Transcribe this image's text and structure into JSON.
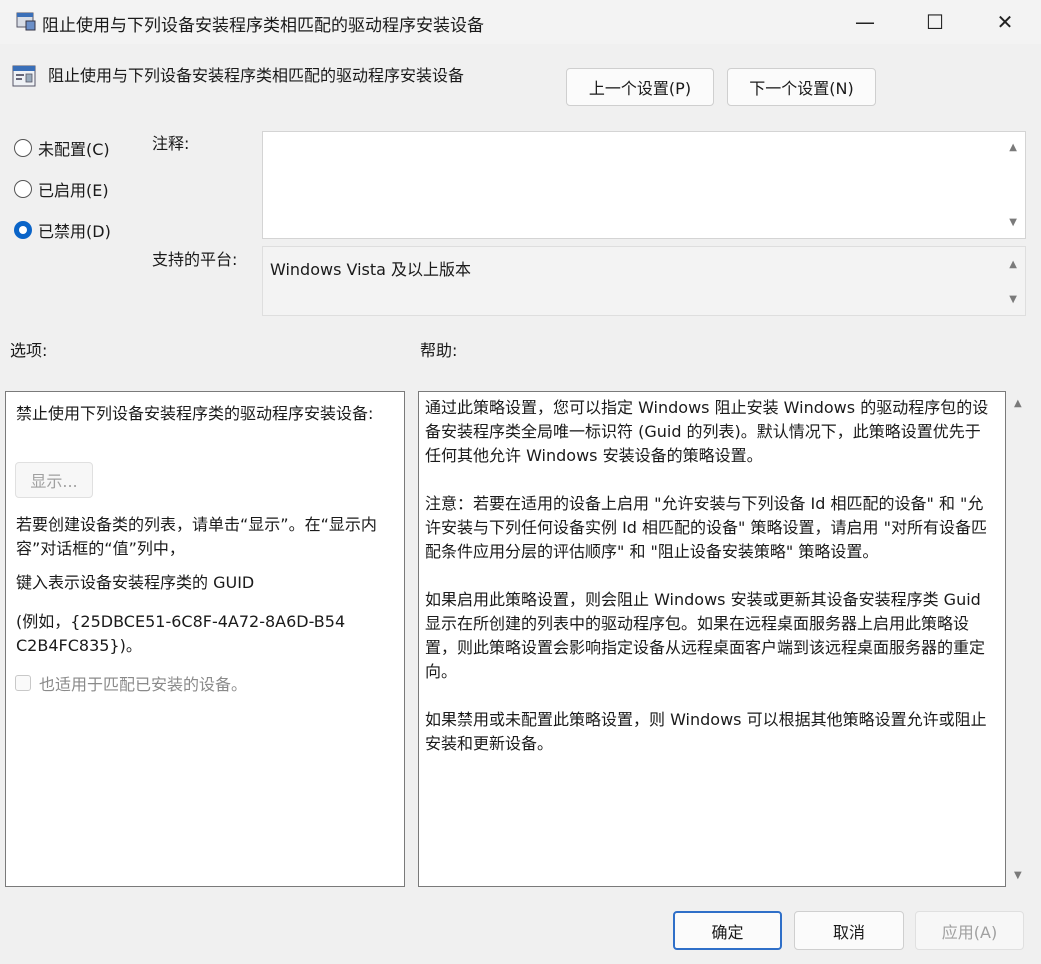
{
  "window": {
    "title": "阻止使用与下列设备安装程序类相匹配的驱动程序安装设备",
    "controls": {
      "minimize": "—",
      "maximize": "☐",
      "close": "✕"
    }
  },
  "header": {
    "policy_name": "阻止使用与下列设备安装程序类相匹配的驱动程序安装设备",
    "prev_button": "上一个设置(P)",
    "next_button": "下一个设置(N)"
  },
  "state": {
    "options": [
      {
        "label": "未配置(C)",
        "checked": false
      },
      {
        "label": "已启用(E)",
        "checked": false
      },
      {
        "label": "已禁用(D)",
        "checked": true
      }
    ]
  },
  "comment": {
    "label": "注释:",
    "value": ""
  },
  "platform": {
    "label": "支持的平台:",
    "value": "Windows Vista 及以上版本"
  },
  "options_section": {
    "label": "选项:",
    "heading": "禁止使用下列设备安装程序类的驱动程序安装设备:",
    "show_button": "显示...",
    "desc1": "若要创建设备类的列表，请单击“显示”。在“显示内容”对话框的“值”列中，",
    "desc2": "键入表示设备安装程序类的 GUID",
    "desc3": "(例如，{25DBCE51-6C8F-4A72-8A6D-B54C2B4FC835})。",
    "checkbox_label": "也适用于匹配已安装的设备。"
  },
  "help_section": {
    "label": "帮助:",
    "paragraphs": [
      "通过此策略设置，您可以指定 Windows 阻止安装 Windows 的驱动程序包的设备安装程序类全局唯一标识符 (Guid 的列表)。默认情况下，此策略设置优先于任何其他允许 Windows 安装设备的策略设置。",
      "注意：若要在适用的设备上启用 \"允许安装与下列设备 Id 相匹配的设备\" 和 \"允许安装与下列任何设备实例 Id 相匹配的设备\" 策略设置，请启用 \"对所有设备匹配条件应用分层的评估顺序\" 和 \"阻止设备安装策略\" 策略设置。",
      "如果启用此策略设置，则会阻止 Windows 安装或更新其设备安装程序类 Guid 显示在所创建的列表中的驱动程序包。如果在远程桌面服务器上启用此策略设置，则此策略设置会影响指定设备从远程桌面客户端到该远程桌面服务器的重定向。",
      "如果禁用或未配置此策略设置，则 Windows 可以根据其他策略设置允许或阻止安装和更新设备。"
    ]
  },
  "footer": {
    "ok": "确定",
    "cancel": "取消",
    "apply": "应用(A)"
  },
  "colors": {
    "accent": "#0a64c8",
    "default_border": "#2f6fc8"
  }
}
